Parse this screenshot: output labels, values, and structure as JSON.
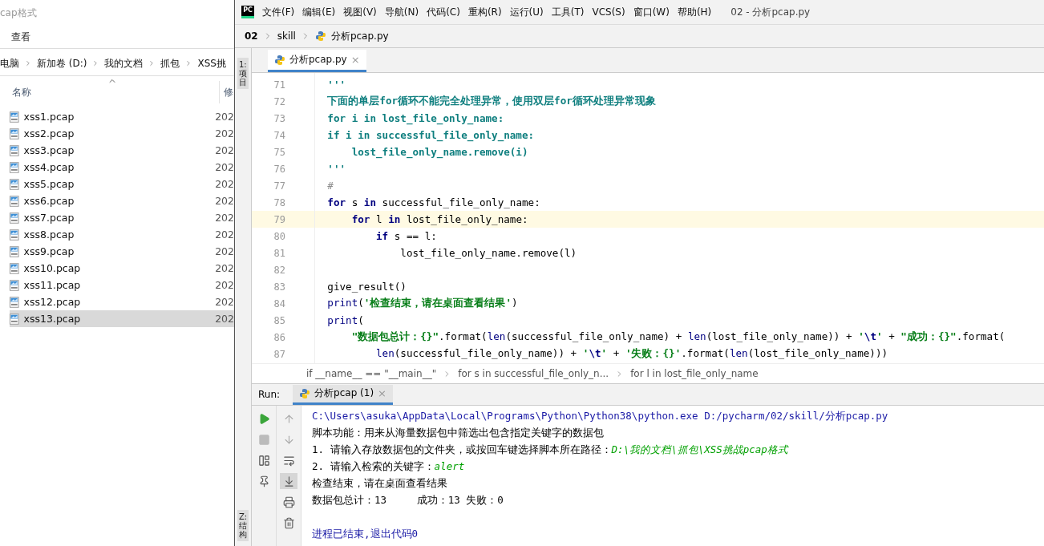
{
  "explorer": {
    "title": "cap格式",
    "menu": [
      "查看"
    ],
    "breadcrumb": [
      "电脑",
      "新加卷 (D:)",
      "我的文档",
      "抓包",
      "XSS挑"
    ],
    "columns": [
      "名称",
      "修"
    ],
    "files": [
      {
        "name": "xss1.pcap",
        "date": "202",
        "selected": false
      },
      {
        "name": "xss2.pcap",
        "date": "202",
        "selected": false
      },
      {
        "name": "xss3.pcap",
        "date": "202",
        "selected": false
      },
      {
        "name": "xss4.pcap",
        "date": "202",
        "selected": false
      },
      {
        "name": "xss5.pcap",
        "date": "202",
        "selected": false
      },
      {
        "name": "xss6.pcap",
        "date": "202",
        "selected": false
      },
      {
        "name": "xss7.pcap",
        "date": "202",
        "selected": false
      },
      {
        "name": "xss8.pcap",
        "date": "202",
        "selected": false
      },
      {
        "name": "xss9.pcap",
        "date": "202",
        "selected": false
      },
      {
        "name": "xss10.pcap",
        "date": "202",
        "selected": false
      },
      {
        "name": "xss11.pcap",
        "date": "202",
        "selected": false
      },
      {
        "name": "xss12.pcap",
        "date": "202",
        "selected": false
      },
      {
        "name": "xss13.pcap",
        "date": "202",
        "selected": true
      }
    ]
  },
  "ide": {
    "logo": "PC",
    "menu": [
      "文件(F)",
      "编辑(E)",
      "视图(V)",
      "导航(N)",
      "代码(C)",
      "重构(R)",
      "运行(U)",
      "工具(T)",
      "VCS(S)",
      "窗口(W)",
      "帮助(H)"
    ],
    "window_title": "02 - 分析pcap.py",
    "nav": {
      "project": "02",
      "folder": "skill",
      "file": "分析pcap.py"
    },
    "left_strip": {
      "top": "1: 项目",
      "bottom": "Z: 结构"
    },
    "tabs": [
      {
        "label": "分析pcap.py",
        "close": "×",
        "selected": true
      }
    ],
    "code": [
      {
        "number": "71",
        "current": false,
        "tokens": [
          {
            "kind": "doc",
            "text": "    '''"
          }
        ]
      },
      {
        "number": "72",
        "current": false,
        "tokens": [
          {
            "kind": "doc",
            "text": "    下面的单层for循环不能完全处理异常，使用双层for循环处理异常现象"
          }
        ]
      },
      {
        "number": "73",
        "current": false,
        "tokens": [
          {
            "kind": "doc",
            "text": "    for i in lost_file_only_name:"
          }
        ]
      },
      {
        "number": "74",
        "current": false,
        "tokens": [
          {
            "kind": "doc",
            "text": "    if i in successful_file_only_name:"
          }
        ]
      },
      {
        "number": "75",
        "current": false,
        "tokens": [
          {
            "kind": "doc",
            "text": "        lost_file_only_name.remove(i)"
          }
        ]
      },
      {
        "number": "76",
        "current": false,
        "tokens": [
          {
            "kind": "doc",
            "text": "    '''"
          }
        ]
      },
      {
        "number": "77",
        "current": false,
        "tokens": [
          {
            "kind": "comment",
            "text": "    #"
          }
        ]
      },
      {
        "number": "78",
        "current": false,
        "tokens": [
          {
            "kind": "kw",
            "text": "    for"
          },
          {
            "kind": "plain",
            "text": " s "
          },
          {
            "kind": "kw",
            "text": "in"
          },
          {
            "kind": "plain",
            "text": " successful_file_only_name:"
          }
        ]
      },
      {
        "number": "79",
        "current": true,
        "tokens": [
          {
            "kind": "kw",
            "text": "        for"
          },
          {
            "kind": "plain",
            "text": " l "
          },
          {
            "kind": "kw",
            "text": "in"
          },
          {
            "kind": "plain",
            "text": " lost_file_only_name:"
          }
        ]
      },
      {
        "number": "80",
        "current": false,
        "tokens": [
          {
            "kind": "kw",
            "text": "            if"
          },
          {
            "kind": "plain",
            "text": " s == l:"
          }
        ]
      },
      {
        "number": "81",
        "current": false,
        "tokens": [
          {
            "kind": "plain",
            "text": "                lost_file_only_name.remove(l)"
          }
        ]
      },
      {
        "number": "82",
        "current": false
      },
      {
        "number": "83",
        "current": false,
        "tokens": [
          {
            "kind": "plain",
            "text": "    give_result()"
          }
        ]
      },
      {
        "number": "84",
        "current": false,
        "tokens": [
          {
            "kind": "builtin",
            "text": "    print"
          },
          {
            "kind": "plain",
            "text": "("
          },
          {
            "kind": "str",
            "text": "'检查结束，请在桌面查看结果'"
          },
          {
            "kind": "plain",
            "text": ")"
          }
        ]
      },
      {
        "number": "85",
        "current": false,
        "tokens": [
          {
            "kind": "builtin",
            "text": "    print"
          },
          {
            "kind": "plain",
            "text": "("
          }
        ]
      },
      {
        "number": "86",
        "current": false,
        "tokens": [
          {
            "kind": "str",
            "text": "        \"数据包总计：{}\""
          },
          {
            "kind": "plain",
            "text": ".format("
          },
          {
            "kind": "builtin",
            "text": "len"
          },
          {
            "kind": "plain",
            "text": "(successful_file_only_name) + "
          },
          {
            "kind": "builtin",
            "text": "len"
          },
          {
            "kind": "plain",
            "text": "(lost_file_only_name)) + "
          },
          {
            "kind": "str",
            "text": "'"
          },
          {
            "kind": "esc",
            "text": "\\t"
          },
          {
            "kind": "str",
            "text": "'"
          },
          {
            "kind": "plain",
            "text": " + "
          },
          {
            "kind": "str",
            "text": "\"成功：{}\""
          },
          {
            "kind": "plain",
            "text": ".format("
          }
        ]
      },
      {
        "number": "87",
        "current": false,
        "tokens": [
          {
            "kind": "builtin",
            "text": "            len"
          },
          {
            "kind": "plain",
            "text": "(successful_file_only_name)) + "
          },
          {
            "kind": "str",
            "text": "'"
          },
          {
            "kind": "esc",
            "text": "\\t"
          },
          {
            "kind": "str",
            "text": "'"
          },
          {
            "kind": "plain",
            "text": " + "
          },
          {
            "kind": "str",
            "text": "'失败：{}'"
          },
          {
            "kind": "plain",
            "text": ".format("
          },
          {
            "kind": "builtin",
            "text": "len"
          },
          {
            "kind": "plain",
            "text": "(lost_file_only_name)))"
          }
        ]
      }
    ],
    "crumbs": [
      "if __name__ == \"__main__\"",
      "for s in successful_file_only_n...",
      "for l in lost_file_only_name"
    ],
    "run": {
      "label": "Run:",
      "tab": {
        "label": "分析pcap (1)",
        "close": "×",
        "selected": true
      },
      "tools_left": [
        {
          "kind": "run"
        },
        {
          "kind": "stop"
        },
        {
          "kind": "layout"
        },
        {
          "kind": "pin"
        }
      ],
      "tools_right": [
        {
          "kind": "up",
          "selected": false
        },
        {
          "kind": "down",
          "selected": false
        },
        {
          "kind": "wrap",
          "selected": false
        },
        {
          "kind": "scroll",
          "selected": true
        },
        {
          "kind": "print",
          "selected": false
        },
        {
          "kind": "trash",
          "selected": false
        }
      ],
      "output": [
        {
          "tokens": [
            {
              "kind": "cmd",
              "text": "C:\\Users\\asuka\\AppData\\Local\\Programs\\Python\\Python38\\python.exe D:/pycharm/02/skill/分析pcap.py"
            }
          ]
        },
        {
          "tokens": [
            {
              "kind": "plain",
              "text": "脚本功能：用来从海量数据包中筛选出包含指定关键字的数据包"
            }
          ]
        },
        {
          "tokens": [
            {
              "kind": "plain",
              "text": "1. 请输入存放数据包的文件夹，或按回车键选择脚本所在路径："
            },
            {
              "kind": "input",
              "text": "D:\\我的文档\\抓包\\XSS挑战pcap格式"
            }
          ]
        },
        {
          "tokens": [
            {
              "kind": "plain",
              "text": "2. 请输入检索的关键字："
            },
            {
              "kind": "input",
              "text": "alert"
            }
          ]
        },
        {
          "tokens": [
            {
              "kind": "plain",
              "text": "检查结束，请在桌面查看结果"
            }
          ]
        },
        {
          "tokens": [
            {
              "kind": "plain",
              "text": "数据包总计：13     成功：13 失败：0"
            }
          ]
        },
        {
          "kind": "exit",
          "tokens": [
            {
              "kind": "cmd",
              "text": "进程已结束,退出代码0"
            }
          ]
        }
      ]
    }
  }
}
